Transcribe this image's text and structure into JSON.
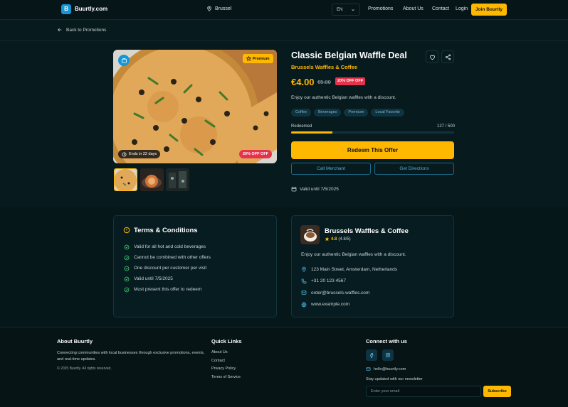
{
  "header": {
    "logo_letter": "B",
    "brand": "Buurtly.com",
    "location": "Brussel",
    "language": "EN",
    "nav": [
      "Promotions",
      "About Us",
      "Contact",
      "Login"
    ],
    "join_label": "Join Buurtly"
  },
  "back_label": "Back to Promotions",
  "gallery": {
    "premium_label": "Premium",
    "ends_label": "Ends in 22 days",
    "discount_label": "20% OFF OFF"
  },
  "offer": {
    "title": "Classic Belgian Waffle Deal",
    "merchant": "Brussels Waffles & Coffee",
    "price": "€4.00",
    "old_price": "€5.00",
    "discount_badge": "20% OFF OFF",
    "description": "Enjoy our authentic Belgian waffles with a discount.",
    "tags": [
      "Coffee",
      "Beverages",
      "Premium",
      "Local Favorite"
    ],
    "redeemed_label": "Redeemed",
    "redeemed_count": "127 / 500",
    "redeemed_fraction": 0.254,
    "redeem_label": "Redeem This Offer",
    "call_label": "Call Merchant",
    "directions_label": "Get Directions",
    "valid_until": "Valid until 7/5/2025"
  },
  "terms": {
    "title": "Terms & Conditions",
    "items": [
      "Valid for all hot and cold beverages",
      "Cannot be combined with other offers",
      "One discount per customer per visit",
      "Valid until 7/5/2025",
      "Must present this offer to redeem"
    ]
  },
  "merchant": {
    "name": "Brussels Waffles & Coffee",
    "rating": "4.8",
    "rating_detail": "(4.8/5)",
    "description": "Enjoy our authentic Belgian waffles with a discount.",
    "address": "123 Main Street, Amsterdam, Netherlands",
    "phone": "+31 20 123 4567",
    "email": "order@brussels-waffles.com",
    "website": "www.example.com"
  },
  "footer": {
    "about_title": "About Buurtly",
    "about_text": "Connecting communities with local businesses through exclusive promotions, events, and real-time updates.",
    "copyright": "© 2025 Buurtly. All rights reserved.",
    "links_title": "Quick Links",
    "links": [
      "About Us",
      "Contact",
      "Privacy Policy",
      "Terms of Service"
    ],
    "connect_title": "Connect with us",
    "email": "hello@buurtly.com",
    "newsletter_label": "Stay updated with our newsletter",
    "email_placeholder": "Enter your email",
    "subscribe_label": "Subscribe"
  },
  "colors": {
    "accent": "#ffb800",
    "brand_blue": "#1596d6",
    "discount_red": "#e5334b",
    "background": "#071a1d"
  }
}
